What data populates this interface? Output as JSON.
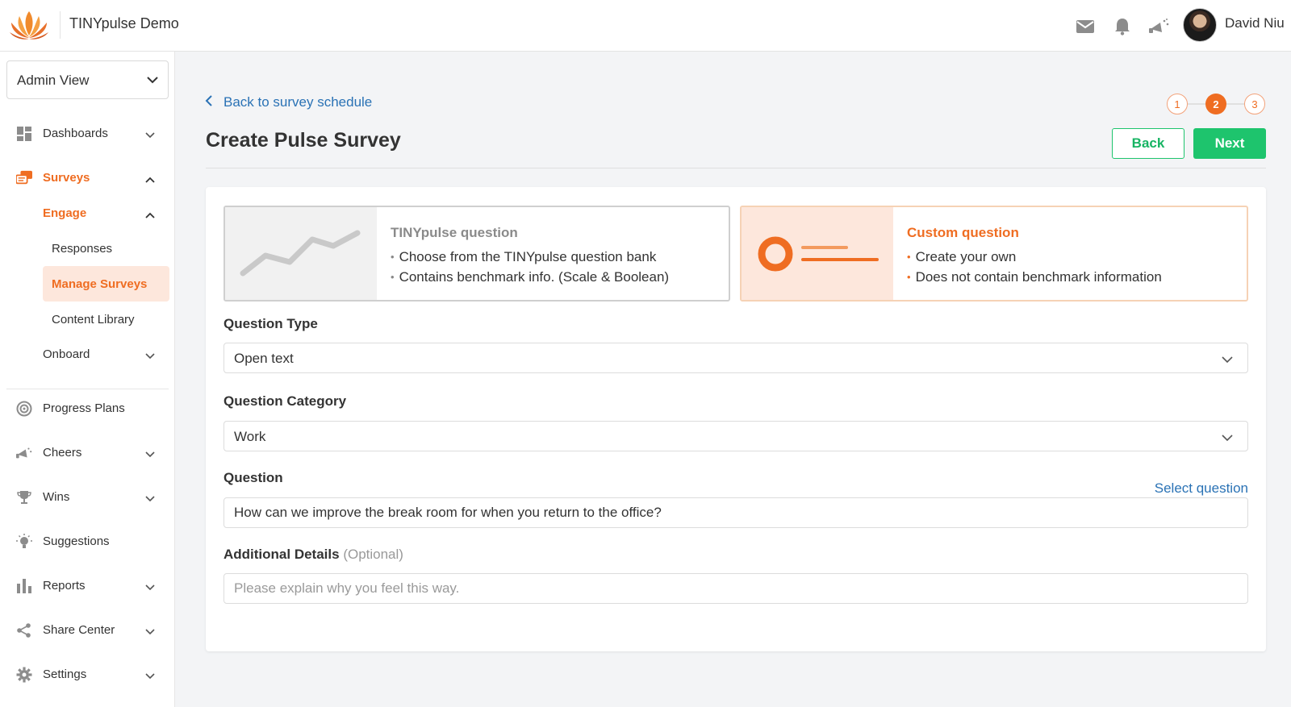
{
  "header": {
    "app_title": "TINYpulse Demo",
    "user_name": "David Niu",
    "icons": [
      "mail-icon",
      "bell-icon",
      "cheers-icon"
    ]
  },
  "sidebar": {
    "view_select": "Admin View",
    "items": [
      {
        "label": "Dashboards",
        "icon": "dashboard-icon"
      },
      {
        "label": "Surveys",
        "icon": "surveys-icon"
      },
      {
        "label": "Engage"
      },
      {
        "label": "Responses"
      },
      {
        "label": "Manage Surveys"
      },
      {
        "label": "Content Library"
      },
      {
        "label": "Onboard"
      },
      {
        "label": "Progress Plans",
        "icon": "target-icon"
      },
      {
        "label": "Cheers",
        "icon": "megaphone-icon"
      },
      {
        "label": "Wins",
        "icon": "trophy-icon"
      },
      {
        "label": "Suggestions",
        "icon": "lightbulb-icon"
      },
      {
        "label": "Reports",
        "icon": "bar-chart-icon"
      },
      {
        "label": "Share Center",
        "icon": "share-icon"
      },
      {
        "label": "Settings",
        "icon": "gear-icon"
      }
    ]
  },
  "main": {
    "back_link": "Back to survey schedule",
    "page_title": "Create Pulse Survey",
    "steps": [
      "1",
      "2",
      "3"
    ],
    "current_step": 2,
    "back_button": "Back",
    "next_button": "Next"
  },
  "question_types": {
    "tinypulse": {
      "title": "TINYpulse question",
      "bullets": [
        "Choose from the TINYpulse question bank",
        "Contains benchmark info. (Scale & Boolean)"
      ]
    },
    "custom": {
      "title": "Custom question",
      "bullets": [
        "Create your own",
        "Does not contain benchmark information"
      ]
    }
  },
  "form": {
    "question_type_label": "Question Type",
    "question_type_value": "Open text",
    "question_category_label": "Question Category",
    "question_category_value": "Work",
    "question_label": "Question",
    "select_question_link": "Select question",
    "question_value": "How can we improve the break room for when you return to the office?",
    "additional_details_label": "Additional Details",
    "additional_details_optional": "(Optional)",
    "additional_details_placeholder": "Please explain why you feel this way."
  },
  "colors": {
    "accent": "#ef6d22",
    "accent_light": "#fde7dc",
    "green": "#1ec46d",
    "link": "#2a72b5"
  }
}
